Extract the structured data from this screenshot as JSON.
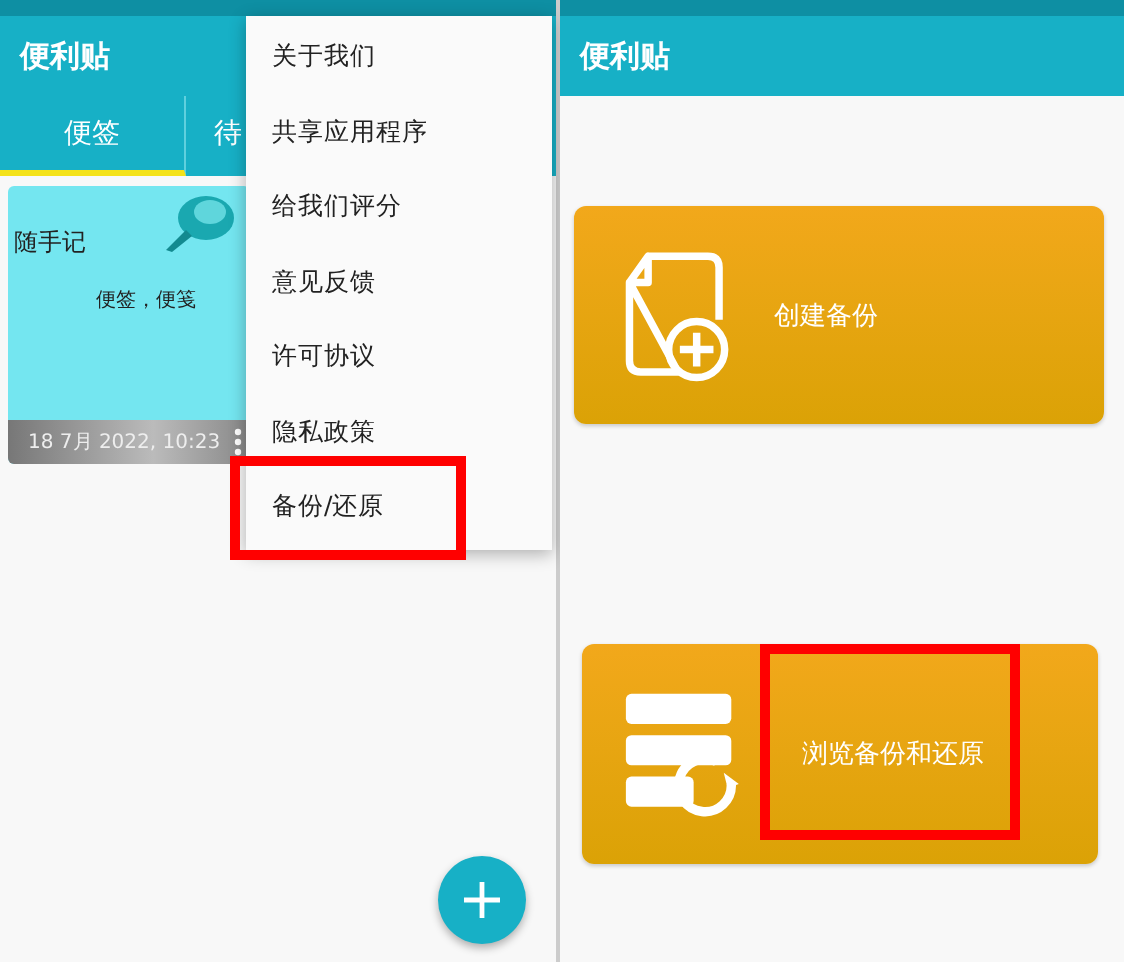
{
  "left_screen": {
    "app_title": "便利贴",
    "tabs": [
      {
        "label": "便签",
        "selected": true
      },
      {
        "label": "待",
        "selected": false
      }
    ],
    "note": {
      "title": "随手记",
      "body": "便签，便笺",
      "timestamp": "18 7月 2022, 10:23"
    },
    "menu": [
      {
        "label": "关于我们",
        "highlighted": false
      },
      {
        "label": "共享应用程序",
        "highlighted": false
      },
      {
        "label": "给我们评分",
        "highlighted": false
      },
      {
        "label": "意见反馈",
        "highlighted": false
      },
      {
        "label": "许可协议",
        "highlighted": false
      },
      {
        "label": "隐私政策",
        "highlighted": false
      },
      {
        "label": "备份/还原",
        "highlighted": true
      }
    ]
  },
  "right_screen": {
    "app_title": "便利贴",
    "actions": [
      {
        "kind": "create",
        "label": "创建备份",
        "highlighted": false
      },
      {
        "kind": "restore",
        "label": "浏览备份和还原",
        "highlighted": true
      }
    ]
  }
}
